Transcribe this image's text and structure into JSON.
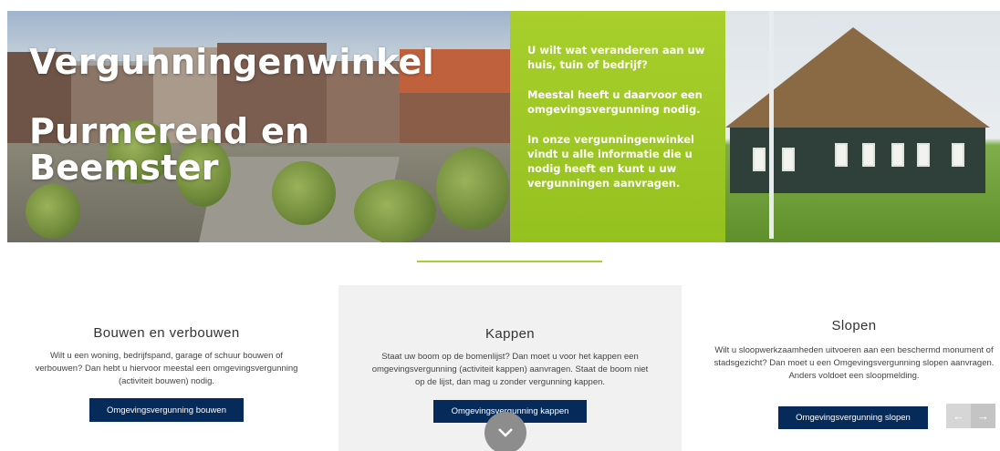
{
  "hero": {
    "title_line1": "Vergunningenwinkel",
    "title_line2": "Purmerend en Beemster",
    "intro": [
      "U wilt wat veranderen aan uw huis, tuin of bedrijf?",
      "Meestal heeft u daarvoor een omgevingsvergunning nodig.",
      "In onze vergunningenwinkel vindt u alle informatie die u nodig heeft en kunt u uw vergunningen aanvragen."
    ],
    "accent_color": "#95c11f"
  },
  "columns": [
    {
      "title": "Bouwen en verbouwen",
      "text": "Wilt u een woning, bedrijfspand, garage of schuur bouwen of verbouwen? Dan hebt u hiervoor meestal een omgevingsvergunning (activiteit bouwen) nodig.",
      "button": "Omgevingsvergunning bouwen"
    },
    {
      "title": "Kappen",
      "text": "Staat uw boom op de bomenlijst? Dan moet u voor het kappen een omgevingsvergunning (activiteit kappen) aanvragen. Staat de boom niet op de lijst, dan mag u zonder vergunning kappen.",
      "button": "Omgevingsvergunning kappen"
    },
    {
      "title": "Slopen",
      "text": "Wilt u sloopwerkzaamheden uitvoeren aan een beschermd monument of stadsgezicht? Dan moet u een Omgevingsvergunning slopen aanvragen. Anders voldoet een sloopmelding.",
      "button": "Omgevingsvergunning slopen"
    }
  ],
  "button_color": "#062b5b",
  "controls": {
    "scroll_icon": "chevron-down-icon",
    "prev_icon": "arrow-left-icon",
    "next_icon": "arrow-right-icon"
  }
}
